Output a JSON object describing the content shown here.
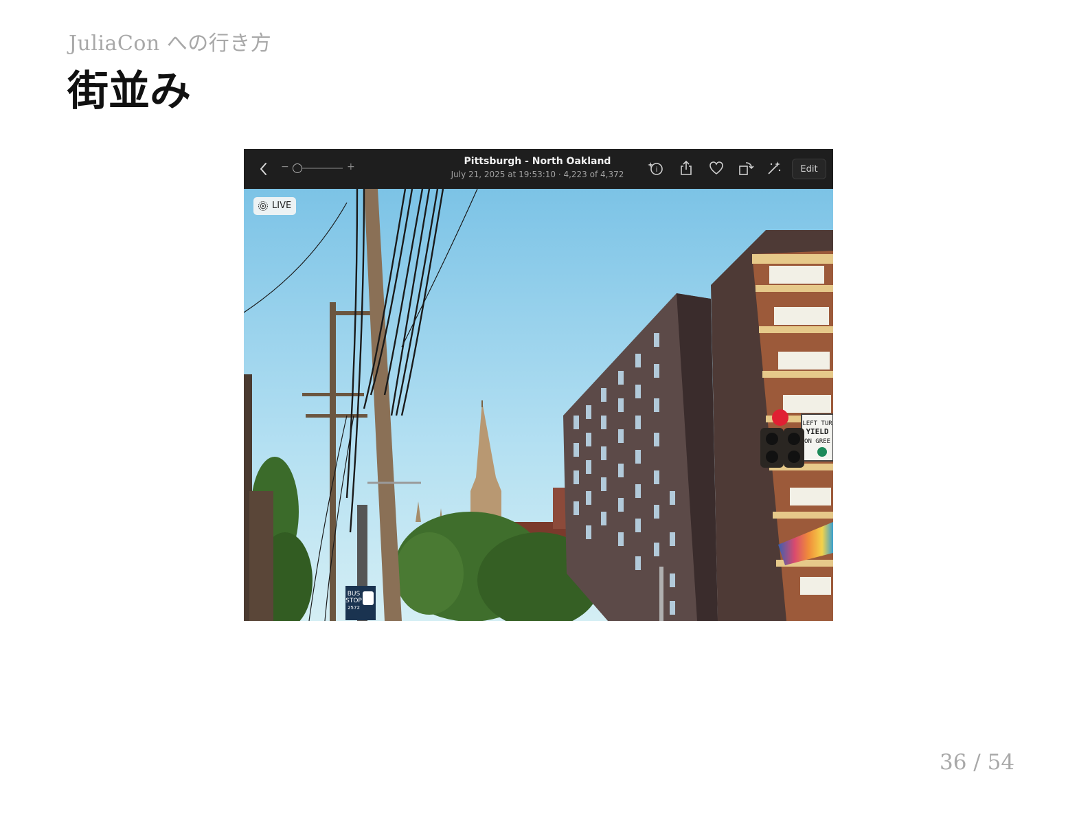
{
  "slide": {
    "subtitle": "JuliaCon への行き方",
    "title": "街並み",
    "page_number": "36 / 54"
  },
  "photos_window": {
    "toolbar": {
      "zoom_minus": "−",
      "zoom_plus": "+",
      "photo_title": "Pittsburgh - North Oakland",
      "photo_meta": "July 21, 2025 at 19:53:10  ·  4,223 of 4,372",
      "edit_label": "Edit",
      "icons": [
        "back-chevron-icon",
        "zoom-slider",
        "info-sparkle-icon",
        "share-icon",
        "favorite-heart-icon",
        "rotate-icon",
        "auto-enhance-wand-icon"
      ]
    },
    "live_badge": {
      "label": "LIVE"
    },
    "photo": {
      "signs": {
        "yield_sign": [
          "LEFT TUR",
          "YIELD",
          "ON GREE"
        ],
        "bus_stop": [
          "BUS",
          "STOP",
          "2572"
        ]
      }
    }
  }
}
